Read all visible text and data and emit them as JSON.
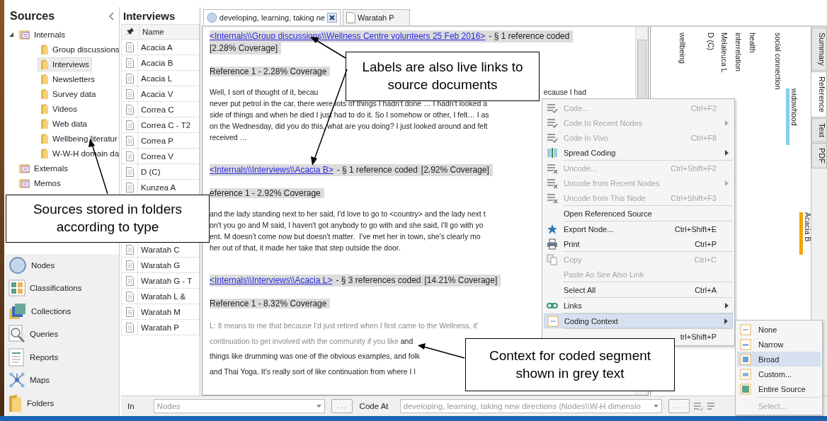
{
  "sources_panel": {
    "title": "Sources",
    "tree": [
      {
        "label": "Internals",
        "expanded": true,
        "selected": false,
        "children": [
          {
            "label": "Group discussions",
            "selected": false
          },
          {
            "label": "Interviews",
            "selected": true
          },
          {
            "label": "Newsletters",
            "selected": false
          },
          {
            "label": "Survey data",
            "selected": false
          },
          {
            "label": "Videos",
            "selected": false
          },
          {
            "label": "Web data",
            "selected": false
          },
          {
            "label": "Wellbeing literatur",
            "selected": false
          },
          {
            "label": "W-W-H domain da",
            "selected": false
          }
        ]
      },
      {
        "label": "Externals",
        "selected": false
      },
      {
        "label": "Memos",
        "selected": false
      }
    ]
  },
  "navigation": [
    {
      "label": "Nodes"
    },
    {
      "label": "Classifications"
    },
    {
      "label": "Collections"
    },
    {
      "label": "Queries"
    },
    {
      "label": "Reports"
    },
    {
      "label": "Maps"
    },
    {
      "label": "Folders"
    }
  ],
  "list_panel": {
    "title": "Interviews",
    "column": "Name",
    "rows_above_callout": [
      "Acacia A",
      "Acacia B",
      "Acacia L",
      "Acacia V",
      "Correa C",
      "Correa C - T2",
      "Correa P",
      "Correa V",
      "D (C)",
      "Kunzea A"
    ],
    "rows_below_callout": [
      "Waratah C",
      "Waratah G",
      "Waratah G - T",
      "Waratah L &",
      "Waratah M",
      "Waratah P"
    ]
  },
  "tabs": [
    {
      "label": "developing, learning, taking ne",
      "kind": "node",
      "selected": true,
      "closable": true
    },
    {
      "label": "Waratah P",
      "kind": "document",
      "selected": false,
      "closable": false
    }
  ],
  "references": [
    {
      "link": "<Internals\\\\Group discussions\\\\Wellness Centre volunteers 25 Feb 2016>",
      "summary": "- § 1 reference coded",
      "coverage": "[2.28% Coverage]",
      "reference": "Reference 1 - 2.28% Coverage",
      "lines": [
        {
          "parts": [
            {
              "text": "Well, I sort of thought of it, becau",
              "context": false
            }
          ],
          "after_callout": "ecause I had"
        },
        {
          "parts": [
            {
              "text": "never put petrol in the car, there were lots of things I hadn't done … I hadn't looked a",
              "context": false
            }
          ]
        },
        {
          "parts": [
            {
              "text": "side of things and when he died I just had to do it. So I somehow or other, I felt… I as",
              "context": false
            }
          ]
        },
        {
          "parts": [
            {
              "text": "on the Wednesday, did you do this, what are you doing? I just looked around and felt",
              "context": false
            }
          ]
        },
        {
          "parts": [
            {
              "text": "received …",
              "context": false
            }
          ]
        }
      ]
    },
    {
      "link": "<Internals\\\\Interviews\\\\Acacia B>",
      "summary": "- § 1 reference coded",
      "coverage": "[2.92% Coverage]",
      "reference": "eference 1 - 2.92% Coverage",
      "lines": [
        {
          "parts": [
            {
              "text": "and the lady standing next to her said, I'd love to go to <country> and the lady next t",
              "context": false
            }
          ]
        },
        {
          "parts": [
            {
              "text": "on't you go and M said, I haven't got anybody to go with and she said, I'll go with yo",
              "context": false
            }
          ]
        },
        {
          "parts": [
            {
              "text": "ent. M doesn't come now but doesn't matter.  I've met her in town, she's clearly mo",
              "context": false
            }
          ]
        },
        {
          "parts": [
            {
              "text": "her out of that, it made her take that step outside the door.",
              "context": false
            }
          ]
        }
      ]
    },
    {
      "link": "<Internals\\\\Interviews\\\\Acacia L>",
      "summary": "- § 3 references coded",
      "coverage": "[14.21% Coverage]",
      "reference": "Reference 1 - 8.32% Coverage",
      "lines": [
        {
          "parts": [
            {
              "text": "L: It means to me that because I'd just retired when I first came to the Wellness, it'",
              "context": true
            }
          ]
        },
        {
          "parts": [
            {
              "text": "continuation to get involved with the community if you like",
              "context": true
            },
            {
              "text": "and",
              "context": false
            }
          ]
        },
        {
          "parts": [
            {
              "text": "things like drumming was one of the obvious examples, and folk",
              "context": false
            }
          ]
        },
        {
          "parts": [
            {
              "text": "and Thai Yoga. It's really sort of like continuation from where I l",
              "context": false
            }
          ]
        }
      ]
    }
  ],
  "coding_stripes": {
    "headers": [
      "wellbeing",
      "D (C)",
      "Melaleuca L",
      "interrelation",
      "health",
      "social connection"
    ],
    "stripes": [
      {
        "label": "widowhood",
        "color": "#87ceeb"
      },
      {
        "label": "Acacia B",
        "color": "#f5a30a"
      }
    ]
  },
  "detail_view_tabs": [
    {
      "label": "Summary",
      "selected": false
    },
    {
      "label": "Reference",
      "selected": true
    },
    {
      "label": "Text",
      "selected": false
    },
    {
      "label": "PDF",
      "selected": false
    }
  ],
  "context_menu": {
    "groups": [
      [
        {
          "label": "Code...",
          "shortcut": "Ctrl+F2",
          "disabled": true,
          "submenu": false,
          "selected": false
        },
        {
          "label": "Code to Recent Nodes",
          "disabled": true,
          "submenu": true,
          "selected": false
        },
        {
          "label": "Code In Vivo",
          "shortcut": "Ctrl+F8",
          "disabled": true,
          "submenu": false,
          "selected": false
        },
        {
          "label": "Spread Coding",
          "disabled": false,
          "submenu": true,
          "selected": false
        }
      ],
      [
        {
          "label": "Uncode...",
          "shortcut": "Ctrl+Shift+F2",
          "disabled": true,
          "submenu": false,
          "selected": false
        },
        {
          "label": "Uncode from Recent Nodes",
          "disabled": true,
          "submenu": true,
          "selected": false
        },
        {
          "label": "Uncode from This Node",
          "shortcut": "Ctrl+Shift+F3",
          "disabled": true,
          "submenu": false,
          "selected": false
        }
      ],
      [
        {
          "label": "Open Referenced Source",
          "disabled": false,
          "submenu": false,
          "selected": false
        }
      ],
      [
        {
          "label": "Export Node...",
          "shortcut": "Ctrl+Shift+E",
          "disabled": false,
          "submenu": false,
          "selected": false
        },
        {
          "label": "Print",
          "shortcut": "Ctrl+P",
          "disabled": false,
          "submenu": false,
          "selected": false
        }
      ],
      [
        {
          "label": "Copy",
          "shortcut": "Ctrl+C",
          "disabled": true,
          "submenu": false,
          "selected": false
        },
        {
          "label": "Paste As See Also Link",
          "disabled": true,
          "submenu": false,
          "selected": false
        }
      ],
      [
        {
          "label": "Select All",
          "shortcut": "Ctrl+A",
          "disabled": false,
          "submenu": false,
          "selected": false
        }
      ],
      [
        {
          "label": "Links",
          "disabled": false,
          "submenu": true,
          "selected": false
        }
      ],
      [
        {
          "label": "Coding Context",
          "disabled": false,
          "submenu": true,
          "selected": true
        }
      ],
      [
        {
          "shortcut": "trl+Shift+P",
          "disabled": false,
          "submenu": false,
          "selected": false
        }
      ]
    ]
  },
  "coding_context_submenu": {
    "groups": [
      [
        {
          "label": "None",
          "disabled": false,
          "selected": false
        },
        {
          "label": "Narrow",
          "disabled": false,
          "selected": false
        },
        {
          "label": "Broad",
          "disabled": false,
          "selected": true
        },
        {
          "label": "Custom...",
          "disabled": false,
          "selected": false
        },
        {
          "label": "Entire Source",
          "disabled": false,
          "selected": false
        }
      ],
      [
        {
          "label": "Select...",
          "disabled": true,
          "selected": false
        }
      ]
    ]
  },
  "code_bar": {
    "in_label": "In",
    "in_field": {
      "value": "Nodes",
      "disabled": true
    },
    "in_browse_button": ". . .",
    "code_at_label": "Code At",
    "code_at_field": {
      "value": "developing, learning, taking new directions (Nodes\\\\W-H dimensio",
      "disabled": true
    },
    "code_at_browse_button": ". . ."
  },
  "annotations": [
    {
      "text": "Labels are also live links to source documents"
    },
    {
      "text": "Sources stored in folders according to type"
    },
    {
      "text": "Context for coded segment shown in grey text"
    }
  ]
}
